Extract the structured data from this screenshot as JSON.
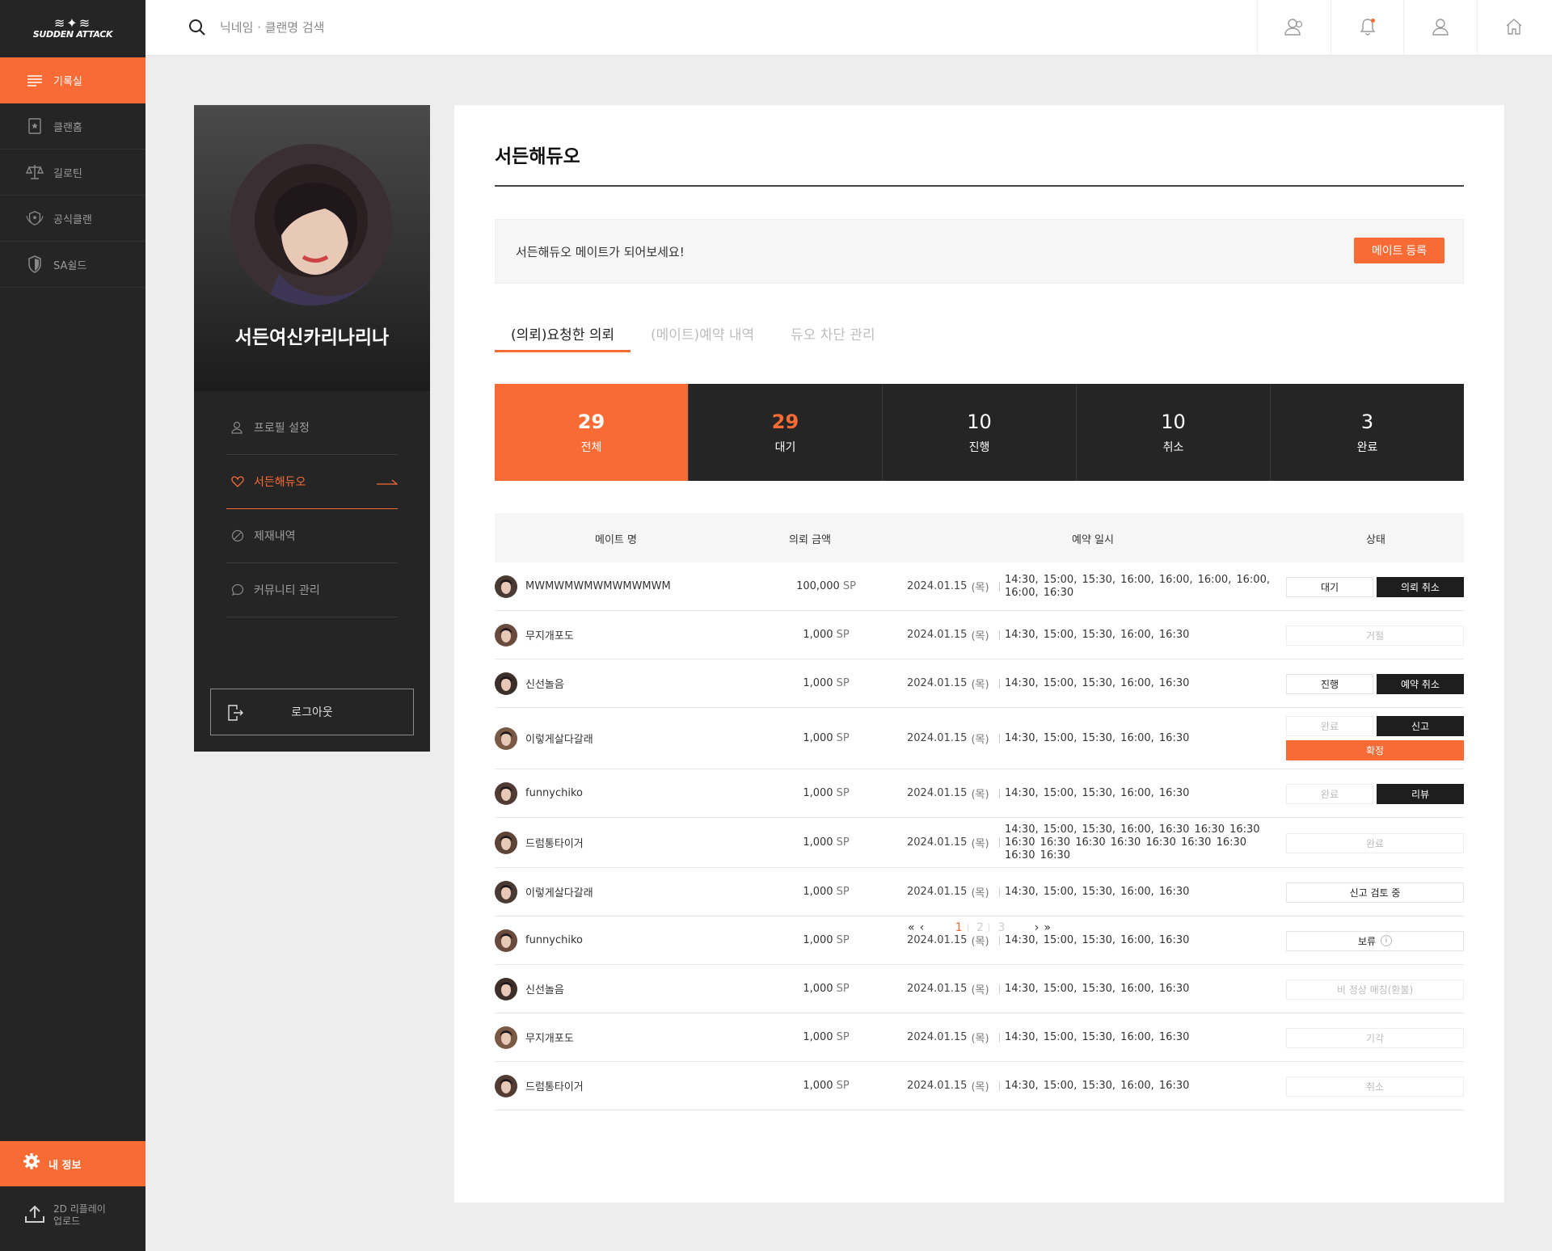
{
  "logo": {
    "text": "SUDDEN ATTACK"
  },
  "leftnav": {
    "items": [
      {
        "label": "기록실",
        "icon": "list-icon",
        "active": true
      },
      {
        "label": "클랜홈",
        "icon": "clan-book-icon",
        "active": false
      },
      {
        "label": "길로틴",
        "icon": "scale-icon",
        "active": false
      },
      {
        "label": "공식클랜",
        "icon": "shield-badge-icon",
        "active": false
      },
      {
        "label": "SA쉴드",
        "icon": "shield-icon",
        "active": false
      }
    ],
    "my_info": "내 정보",
    "upload_line1": "2D 리플레이",
    "upload_line2": "업로드"
  },
  "search": {
    "placeholder": "닉네임 · 클랜명 검색"
  },
  "profile": {
    "name": "서든여신카리나리나",
    "menu": [
      {
        "label": "프로필 설정",
        "icon": "person-icon",
        "active": false
      },
      {
        "label": "서든해듀오",
        "icon": "heart-icon",
        "active": true
      },
      {
        "label": "제재내역",
        "icon": "ban-icon",
        "active": false
      },
      {
        "label": "커뮤니티 관리",
        "icon": "chat-icon",
        "active": false
      }
    ],
    "logout": "로그아웃"
  },
  "main": {
    "title": "서든해듀오",
    "banner_text": "서든해듀오 메이트가 되어보세요!",
    "register_button": "메이트 등록",
    "tabs": [
      {
        "label": "(의뢰)요청한 의뢰",
        "active": true
      },
      {
        "label": "(메이트)예약 내역",
        "active": false
      },
      {
        "label": "듀오 차단 관리",
        "active": false
      }
    ],
    "stats": [
      {
        "num": "29",
        "label": "전체"
      },
      {
        "num": "29",
        "label": "대기"
      },
      {
        "num": "10",
        "label": "진행"
      },
      {
        "num": "10",
        "label": "취소"
      },
      {
        "num": "3",
        "label": "완료"
      }
    ],
    "headers": [
      "메이트 명",
      "의뢰 금액",
      "예약 일시",
      "상태"
    ],
    "rows": [
      {
        "name": "MWMWMWMWMWMWMWM",
        "amount": "100,000",
        "unit": "SP",
        "date": "2024.01.15",
        "weekday": "(목)",
        "times": "14:30, 15:00, 15:30, 16:00, 16:00, 16:00, 16:00, 16:00, 16:30",
        "status": [
          "대기",
          "의뢰 취소"
        ]
      },
      {
        "name": "무지개포도",
        "amount": "1,000",
        "unit": "SP",
        "date": "2024.01.15",
        "weekday": "(목)",
        "times": "14:30, 15:00, 15:30, 16:00, 16:30",
        "status": [
          "거절"
        ]
      },
      {
        "name": "신선놀음",
        "amount": "1,000",
        "unit": "SP",
        "date": "2024.01.15",
        "weekday": "(목)",
        "times": "14:30, 15:00, 15:30, 16:00, 16:30",
        "status": [
          "진행",
          "예약 취소"
        ]
      },
      {
        "name": "이렇게살다갈래",
        "amount": "1,000",
        "unit": "SP",
        "date": "2024.01.15",
        "weekday": "(목)",
        "times": "14:30, 15:00, 15:30, 16:00, 16:30",
        "status": [
          "완료",
          "신고",
          "확정"
        ]
      },
      {
        "name": "funnychiko",
        "amount": "1,000",
        "unit": "SP",
        "date": "2024.01.15",
        "weekday": "(목)",
        "times": "14:30, 15:00, 15:30, 16:00, 16:30",
        "status": [
          "완료",
          "리뷰"
        ]
      },
      {
        "name": "드럼통타이거",
        "amount": "1,000",
        "unit": "SP",
        "date": "2024.01.15",
        "weekday": "(목)",
        "times": "14:30, 15:00, 15:30, 16:00, 16:30 16:30 16:30 16:30 16:30 16:30 16:30 16:30 16:30 16:30 16:30 16:30",
        "status": [
          "완료"
        ]
      },
      {
        "name": "이렇게살다갈래",
        "amount": "1,000",
        "unit": "SP",
        "date": "2024.01.15",
        "weekday": "(목)",
        "times": "14:30, 15:00, 15:30, 16:00, 16:30",
        "status": [
          "신고 검토 중"
        ]
      },
      {
        "name": "funnychiko",
        "amount": "1,000",
        "unit": "SP",
        "date": "2024.01.15",
        "weekday": "(목)",
        "times": "14:30, 15:00, 15:30, 16:00, 16:30",
        "status": [
          "보류"
        ]
      },
      {
        "name": "신선놀음",
        "amount": "1,000",
        "unit": "SP",
        "date": "2024.01.15",
        "weekday": "(목)",
        "times": "14:30, 15:00, 15:30, 16:00, 16:30",
        "status": [
          "비 정상 매칭(환불)"
        ]
      },
      {
        "name": "무지개포도",
        "amount": "1,000",
        "unit": "SP",
        "date": "2024.01.15",
        "weekday": "(목)",
        "times": "14:30, 15:00, 15:30, 16:00, 16:30",
        "status": [
          "기각"
        ]
      },
      {
        "name": "드럼통타이거",
        "amount": "1,000",
        "unit": "SP",
        "date": "2024.01.15",
        "weekday": "(목)",
        "times": "14:30, 15:00, 15:30, 16:00, 16:30",
        "status": [
          "취소"
        ]
      }
    ],
    "pagination": {
      "first": "«",
      "prev": "‹",
      "pages": [
        "1",
        "2",
        "3"
      ],
      "next": "›",
      "last": "»"
    }
  },
  "colors": {
    "accent": "#f86b35",
    "dark": "#252525",
    "background": "#ededed"
  }
}
